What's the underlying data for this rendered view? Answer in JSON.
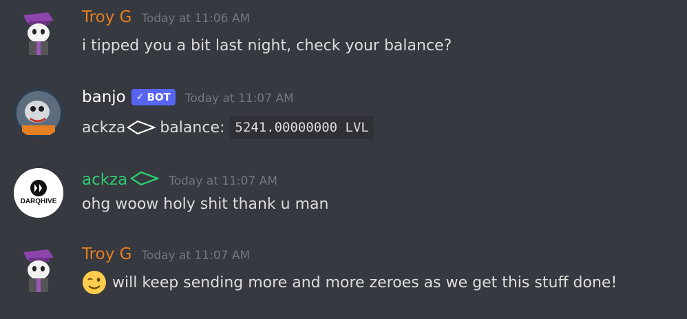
{
  "colors": {
    "background": "#36393f",
    "troy_name": "#e67e22",
    "banjo_name": "#ffffff",
    "ackza_name": "#2ecc71",
    "timestamp": "#72767d",
    "text": "#dcddde",
    "bot_badge": "#5865f2"
  },
  "messages": [
    {
      "author": "Troy G",
      "timestamp": "Today at 11:06 AM",
      "text": "i tipped you a bit last night, check your balance?",
      "avatar_icon": "gangster-bunny-avatar"
    },
    {
      "author": "banjo",
      "bot_badge": "BOT",
      "timestamp": "Today at 11:07 AM",
      "text_prefix": "ackza",
      "text_middle": "balance:",
      "code": "5241.00000000 LVL",
      "avatar_icon": "banjo-bot-avatar",
      "inline_icon": "white-diamond-icon"
    },
    {
      "author": "ackza",
      "timestamp": "Today at 11:07 AM",
      "text": "ohg woow holy shit thank u man",
      "avatar_label": "DARQHIVE",
      "avatar_icon": "darqhive-logo-avatar",
      "name_icon": "green-diamond-icon"
    },
    {
      "author": "Troy G",
      "timestamp": "Today at 11:07 AM",
      "text": "will keep sending more and more zeroes as we get this stuff done!",
      "emoji": "winking-face-emoji",
      "avatar_icon": "gangster-bunny-avatar"
    }
  ]
}
